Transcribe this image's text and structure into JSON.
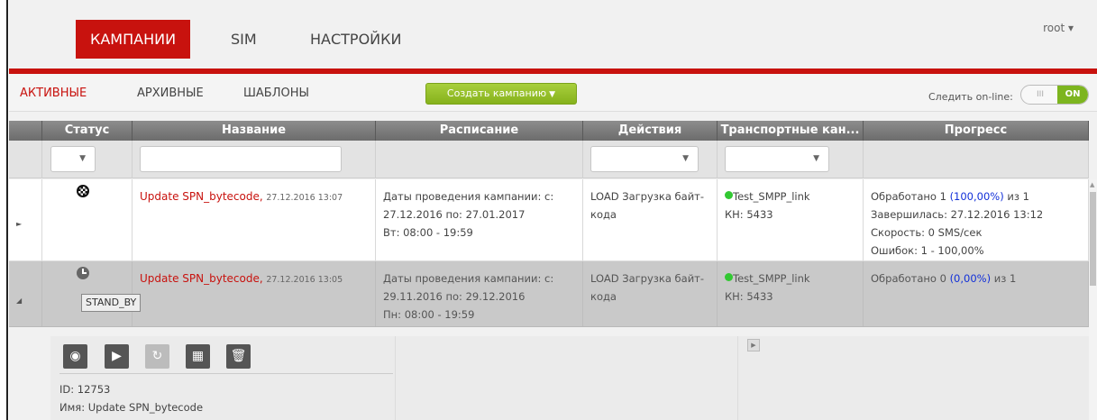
{
  "nav": {
    "tabs": [
      "КАМПАНИИ",
      "SIM",
      "НАСТРОЙКИ"
    ],
    "user": "root ▾"
  },
  "subnav": {
    "tabs": [
      "АКТИВНЫЕ",
      "АРХИВНЫЕ",
      "ШАБЛОНЫ"
    ],
    "create_label": "Создать кампанию",
    "online_label": "Следить on-line:",
    "toggle_off": "III",
    "toggle_on": "ON"
  },
  "grid": {
    "headers": [
      "Статус",
      "Название",
      "Расписание",
      "Действия",
      "Транспортные кан...",
      "Прогресс"
    ],
    "rows": [
      {
        "name": "Update SPN_bytecode,",
        "date": "27.12.2016 13:07",
        "schedule": [
          "Даты проведения кампании: с:",
          "27.12.2016 по: 27.01.2017",
          "Вт: 08:00 - 19:59"
        ],
        "action": [
          "LOAD Загрузка байт-",
          "кода"
        ],
        "transport": [
          "Test_SMPP_link",
          "КН: 5433"
        ],
        "progress": {
          "line1_pre": "Обработано 1 ",
          "line1_pct": "(100,00%)",
          "line1_post": " из 1",
          "line2": "Завершилась: 27.12.2016 13:12",
          "line3": "Скорость: 0 SMS/сек",
          "line4": "Ошибок: 1 - 100,00%"
        }
      },
      {
        "name": "Update SPN_bytecode,",
        "date": "27.12.2016 13:05",
        "schedule": [
          "Даты проведения кампании: с:",
          "29.11.2016 по: 29.12.2016",
          "Пн: 08:00 - 19:59"
        ],
        "action": [
          "LOAD Загрузка байт-",
          "кода"
        ],
        "transport": [
          "Test_SMPP_link",
          "КН: 5433"
        ],
        "progress": {
          "line1_pre": "Обработано 0 ",
          "line1_pct": "(0,00%)",
          "line1_post": " из 1"
        },
        "tooltip": "STAND_BY"
      }
    ]
  },
  "details": {
    "id_line": "ID: 12753",
    "name_line": "Имя: Update SPN_bytecode"
  },
  "colors": {
    "accent": "#c8120e",
    "create_button": "#95c02a",
    "toggle_on": "#7db51f",
    "link": "#c8120e",
    "percent": "#1230d8"
  }
}
